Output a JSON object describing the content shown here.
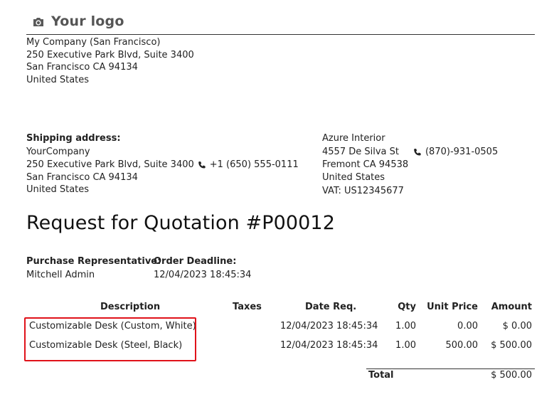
{
  "logo": {
    "text": "Your logo",
    "icon": "camera-icon"
  },
  "company": {
    "lines": [
      "My Company (San Francisco)",
      "250 Executive Park Blvd, Suite 3400",
      "San Francisco CA 94134",
      "United States"
    ]
  },
  "shipping": {
    "label": "Shipping address:",
    "name": "YourCompany",
    "street": "250 Executive Park Blvd, Suite 3400",
    "phone": "+1 (650) 555-0111",
    "city": "San Francisco CA 94134",
    "country": "United States"
  },
  "vendor": {
    "name": "Azure Interior",
    "street": "4557 De Silva St",
    "phone": "(870)-931-0505",
    "city": "Fremont CA 94538",
    "country": "United States",
    "vat": "VAT: US12345677"
  },
  "title": "Request for Quotation #P00012",
  "info": {
    "rep_label": "Purchase Representative:",
    "rep_value": "Mitchell Admin",
    "deadline_label": "Order Deadline:",
    "deadline_value": "12/04/2023 18:45:34"
  },
  "table": {
    "headers": {
      "description": "Description",
      "taxes": "Taxes",
      "date": "Date Req.",
      "qty": "Qty",
      "unit_price": "Unit Price",
      "amount": "Amount"
    },
    "rows": [
      {
        "description": "Customizable Desk (Custom, White)",
        "taxes": "",
        "date": "12/04/2023 18:45:34",
        "qty": "1.00",
        "unit_price": "0.00",
        "amount": "$ 0.00"
      },
      {
        "description": "Customizable Desk (Steel, Black)",
        "taxes": "",
        "date": "12/04/2023 18:45:34",
        "qty": "1.00",
        "unit_price": "500.00",
        "amount": "$ 500.00"
      }
    ],
    "total_label": "Total",
    "total_value": "$ 500.00"
  },
  "colors": {
    "highlight": "#e0121a",
    "text": "#222222",
    "logo": "#555555"
  }
}
